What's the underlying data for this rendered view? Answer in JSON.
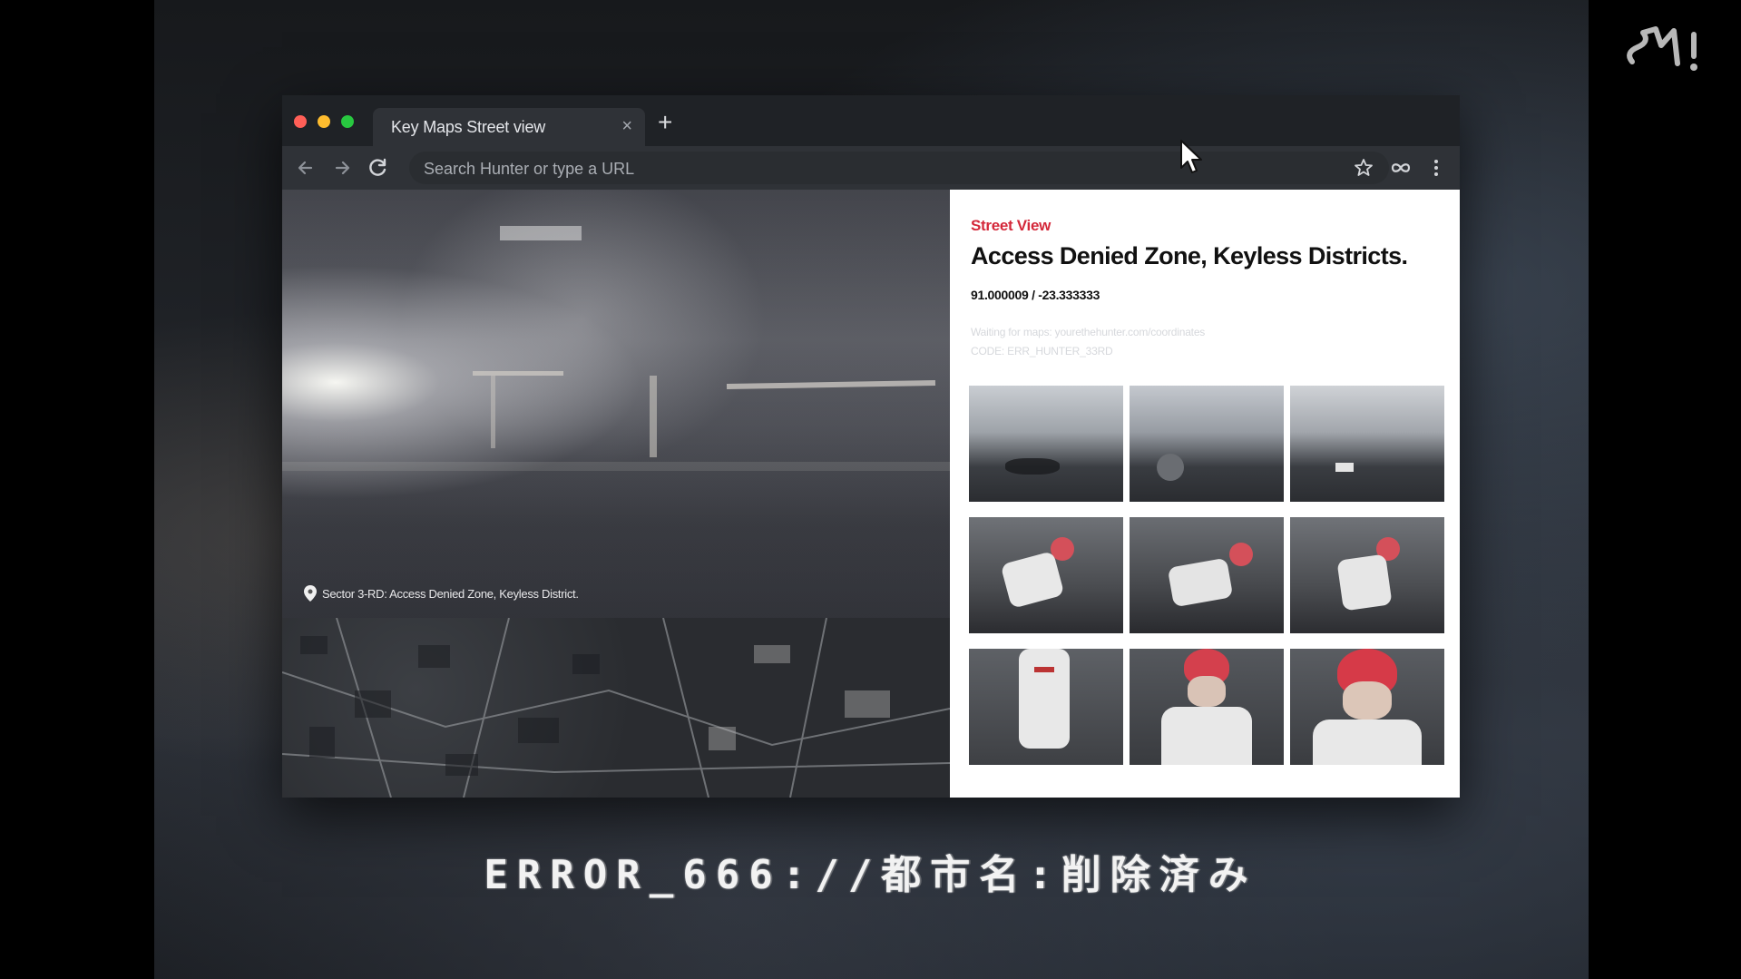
{
  "browser": {
    "tab_title": "Key Maps Street view",
    "tab_close": "×",
    "new_tab": "+",
    "address_placeholder": "Search Hunter or type a URL"
  },
  "street_view": {
    "caption": "Sector 3-RD: Access Denied Zone, Keyless District."
  },
  "panel": {
    "label": "Street View",
    "title": "Access Denied Zone, Keyless Districts.",
    "coordinates": "91.000009 / -23.333333",
    "faint_line_1": "Waiting for maps: yourethehunter.com/coordinates",
    "faint_line_2": "CODE: ERR_HUNTER_33RD"
  },
  "overlay": {
    "error_text": "ERROR_666://都市名:削除済み"
  },
  "icons": {
    "back": "arrow-left-icon",
    "forward": "arrow-right-icon",
    "reload": "reload-icon",
    "bookmark": "star-icon",
    "extension": "infinity-icon",
    "menu": "kebab-menu-icon",
    "location": "map-pin-icon",
    "logo": "sm-logo"
  },
  "colors": {
    "accent_red": "#d4283a",
    "tab_bar": "#1f2226",
    "toolbar": "#2f3237",
    "traffic_red": "#ff5f57",
    "traffic_yellow": "#febc2e",
    "traffic_green": "#28c840"
  }
}
